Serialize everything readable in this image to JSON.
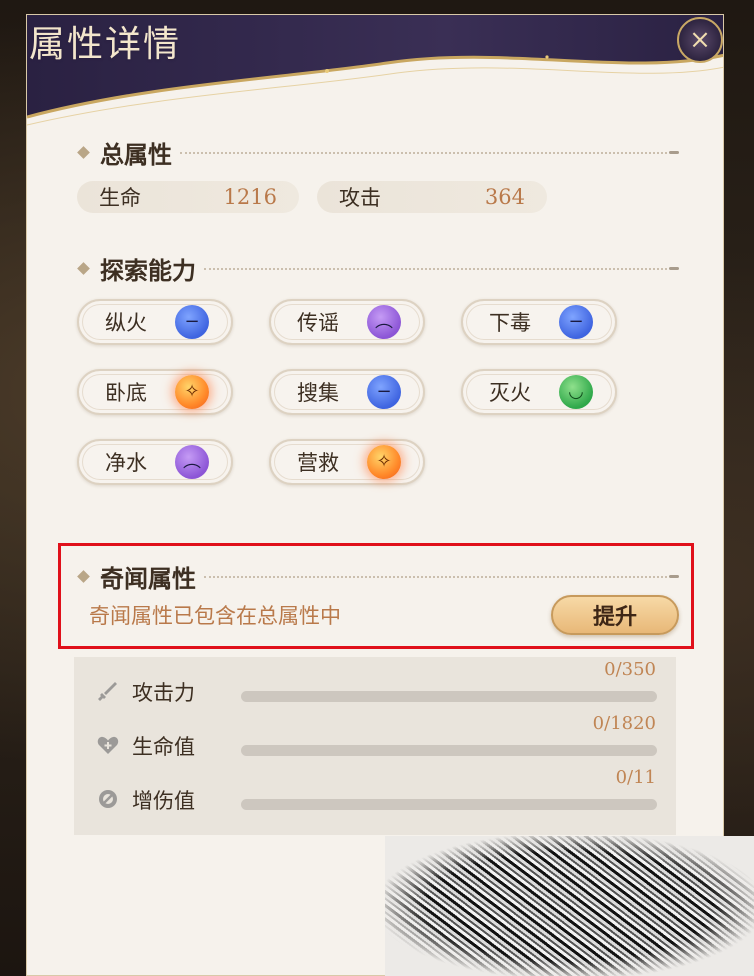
{
  "title": "属性详情",
  "close_icon": "×",
  "sections": {
    "total": {
      "title": "总属性"
    },
    "explore": {
      "title": "探索能力"
    },
    "curio": {
      "title": "奇闻属性",
      "note": "奇闻属性已包含在总属性中",
      "upgrade_label": "提升"
    }
  },
  "stats": [
    {
      "label": "生命",
      "value": "1216"
    },
    {
      "label": "攻击",
      "value": "364"
    }
  ],
  "abilities": [
    {
      "label": "纵火",
      "mood": "neutral",
      "color": "blue",
      "face": "−"
    },
    {
      "label": "传谣",
      "mood": "sad",
      "color": "purple",
      "face": "︵"
    },
    {
      "label": "下毒",
      "mood": "neutral",
      "color": "blue",
      "face": "−"
    },
    {
      "label": "卧底",
      "mood": "excited",
      "color": "orange",
      "face": "✧"
    },
    {
      "label": "搜集",
      "mood": "neutral",
      "color": "blue",
      "face": "−"
    },
    {
      "label": "灭火",
      "mood": "happy",
      "color": "green",
      "face": "◡"
    },
    {
      "label": "净水",
      "mood": "sad",
      "color": "purple",
      "face": "︵"
    },
    {
      "label": "营救",
      "mood": "excited",
      "color": "orange",
      "face": "✧"
    }
  ],
  "bonuses": [
    {
      "label": "攻击力",
      "value": "0/350",
      "progress": 0,
      "icon": "sword-icon"
    },
    {
      "label": "生命值",
      "value": "0/1820",
      "progress": 0,
      "icon": "heart-plus-icon"
    },
    {
      "label": "增伤值",
      "value": "0/11",
      "progress": 0,
      "icon": "damage-boost-icon"
    }
  ],
  "colors": {
    "accent": "#b9794a",
    "highlight": "#e0101a",
    "header": "#2e2440"
  }
}
